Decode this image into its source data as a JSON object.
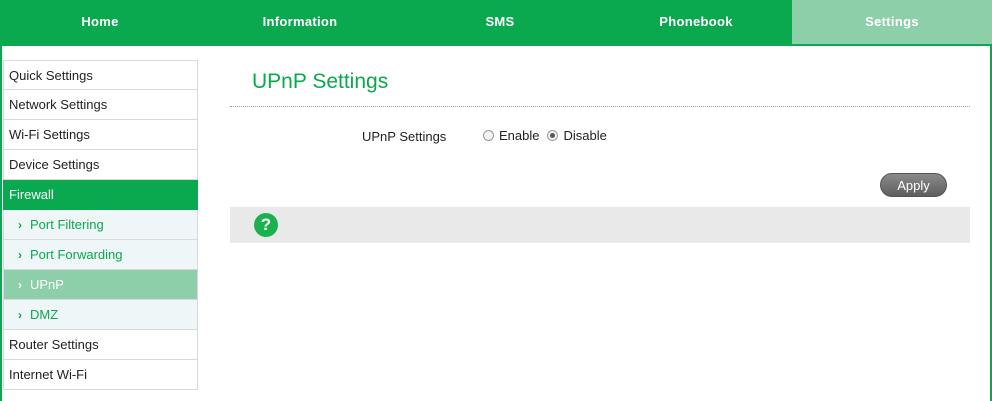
{
  "topnav": {
    "tabs": [
      {
        "label": "Home"
      },
      {
        "label": "Information"
      },
      {
        "label": "SMS"
      },
      {
        "label": "Phonebook"
      },
      {
        "label": "Settings"
      }
    ]
  },
  "sidebar": {
    "items": [
      {
        "label": "Quick Settings"
      },
      {
        "label": "Network Settings"
      },
      {
        "label": "Wi-Fi Settings"
      },
      {
        "label": "Device Settings"
      },
      {
        "label": "Firewall"
      },
      {
        "label": "Port Filtering"
      },
      {
        "label": "Port Forwarding"
      },
      {
        "label": "UPnP"
      },
      {
        "label": "DMZ"
      },
      {
        "label": "Router Settings"
      },
      {
        "label": "Internet Wi-Fi"
      }
    ]
  },
  "main": {
    "title": "UPnP Settings",
    "form": {
      "label": "UPnP Settings",
      "options": [
        "Enable",
        "Disable"
      ],
      "selected": "Disable"
    },
    "apply_label": "Apply",
    "help_glyph": "?"
  },
  "colors": {
    "accent": "#0aa84f",
    "accent_light": "#8dcfa8",
    "sub_bg": "#eef6f7"
  }
}
